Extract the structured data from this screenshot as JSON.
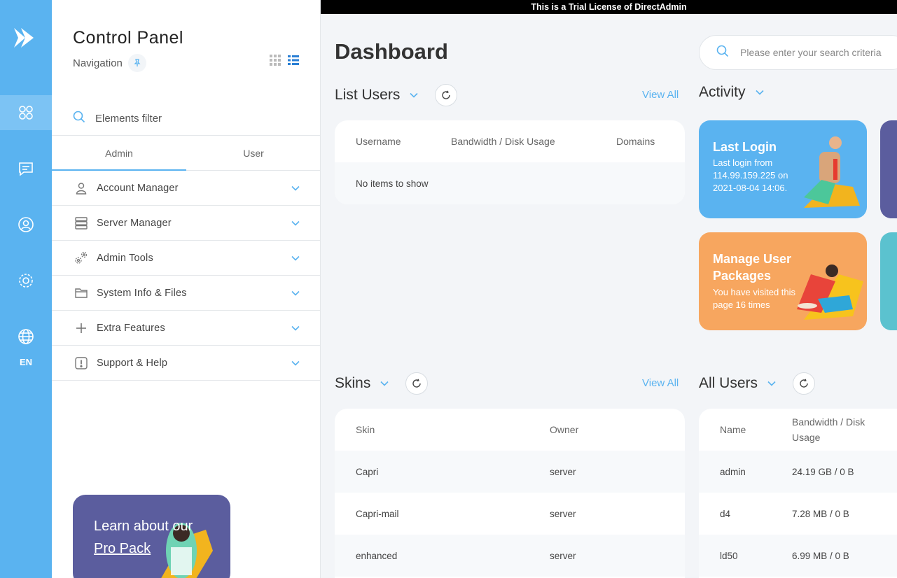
{
  "trial_banner": "This is a Trial License of DirectAdmin",
  "rail": {
    "lang": "EN"
  },
  "nav": {
    "title": "Control Panel",
    "subtitle": "Navigation",
    "filter_placeholder": "Elements filter",
    "tabs": [
      "Admin",
      "User"
    ],
    "menu": [
      "Account Manager",
      "Server Manager",
      "Admin Tools",
      "System Info & Files",
      "Extra Features",
      "Support & Help"
    ]
  },
  "promo": {
    "line1": "Learn about our",
    "line2": "Pro Pack"
  },
  "page": {
    "title": "Dashboard",
    "search_placeholder": "Please enter your search criteria"
  },
  "list_users": {
    "title": "List Users",
    "view_all": "View All",
    "columns": [
      "Username",
      "Bandwidth / Disk Usage",
      "Domains"
    ],
    "empty": "No items to show"
  },
  "activity": {
    "title": "Activity",
    "tiles": [
      {
        "title": "Last Login",
        "desc": "Last login from 114.99.159.225 on 2021-08-04 14:06."
      },
      {
        "title": "Manage User Packages",
        "desc": "You have visited this page 16 times"
      }
    ]
  },
  "skins": {
    "title": "Skins",
    "view_all": "View All",
    "columns": [
      "Skin",
      "Owner"
    ],
    "rows": [
      [
        "Capri",
        "server"
      ],
      [
        "Capri-mail",
        "server"
      ],
      [
        "enhanced",
        "server"
      ]
    ]
  },
  "all_users": {
    "title": "All Users",
    "columns": [
      "Name",
      "Bandwidth / Disk Usage"
    ],
    "rows": [
      [
        "admin",
        "24.19 GB / 0 B"
      ],
      [
        "d4",
        "7.28 MB / 0 B"
      ],
      [
        "ld50",
        "6.99 MB / 0 B"
      ]
    ]
  },
  "colors": {
    "accent": "#5ab3f0",
    "purple": "#5b5d9e",
    "orange": "#f7a65f",
    "teal": "#5bc2cf"
  }
}
